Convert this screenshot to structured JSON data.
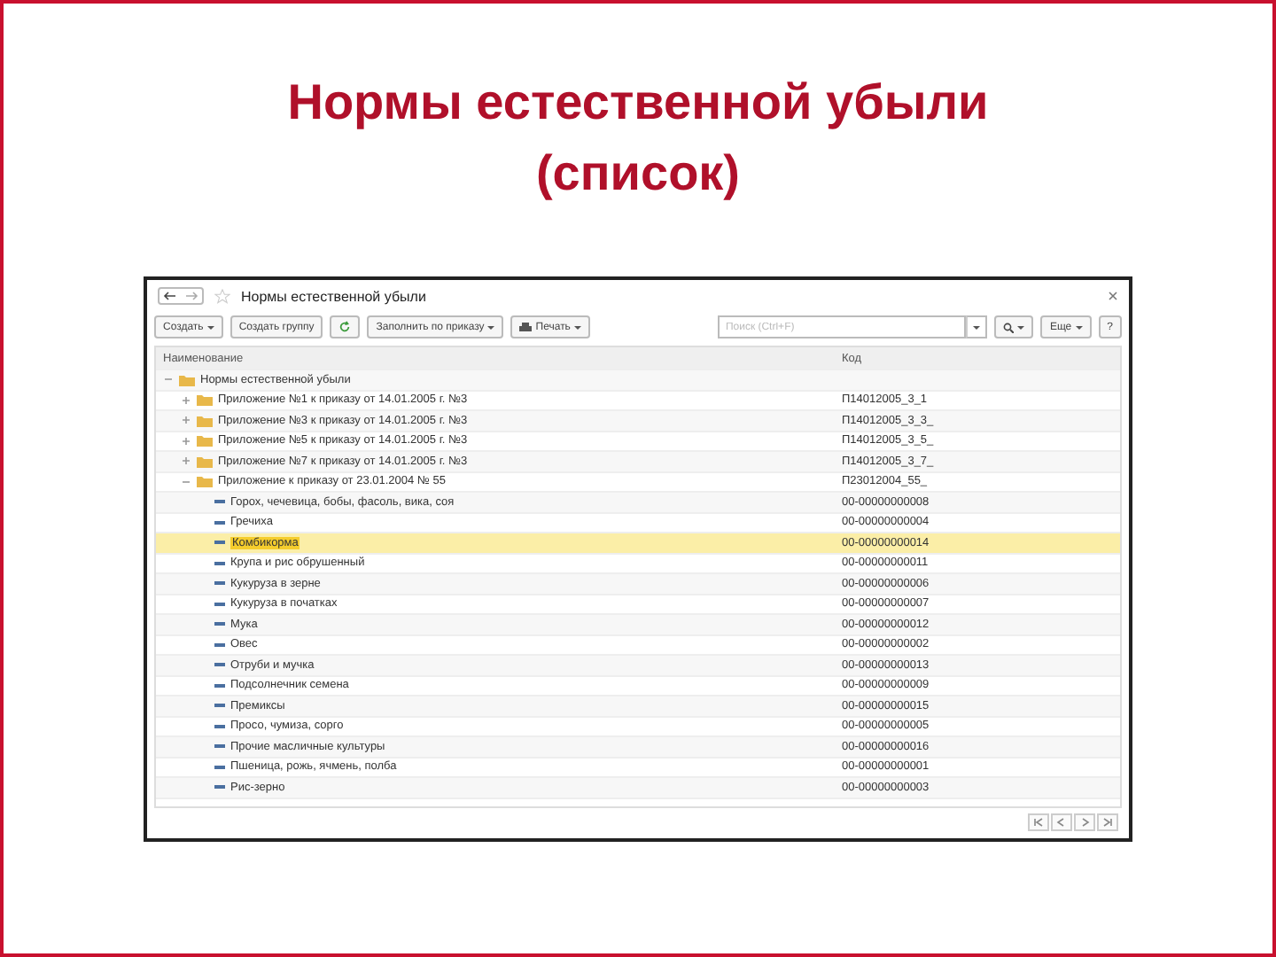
{
  "slide_title": "Нормы естественной убыли",
  "slide_subtitle": "(список)",
  "window": {
    "title": "Нормы естественной убыли",
    "favorite": false
  },
  "toolbar": {
    "buttons": [
      {
        "label": "Создать",
        "kind": "dropdown"
      },
      {
        "label": "Создать группу",
        "kind": "plain"
      },
      {
        "kind": "refresh"
      },
      {
        "label": "Заполнить по приказу",
        "kind": "dropdown"
      },
      {
        "label": "Печать",
        "kind": "print"
      }
    ],
    "search": {
      "placeholder": "Поиск (Ctrl+F)"
    },
    "more": "Еще",
    "help": "?"
  },
  "table": {
    "columns": [
      "Наименование",
      "Код"
    ],
    "rows": [
      {
        "kind": "group",
        "name": "Нормы естественной убыли",
        "code": "",
        "expanded": true,
        "selected": false,
        "children": [
          {
            "kind": "group",
            "name": "Приложение №1 к приказу от 14.01.2005 г. №3",
            "code": "П14012005_3_1",
            "expanded": false,
            "selected": false
          },
          {
            "kind": "group",
            "name": "Приложение №3 к приказу от 14.01.2005 г. №3",
            "code": "П14012005_3_3_",
            "expanded": false,
            "selected": false
          },
          {
            "kind": "group",
            "name": "Приложение №5 к приказу от 14.01.2005 г. №3",
            "code": "П14012005_3_5_",
            "expanded": false,
            "selected": false
          },
          {
            "kind": "group",
            "name": "Приложение №7 к приказу от 14.01.2005 г. №3",
            "code": "П14012005_3_7_",
            "expanded": false,
            "selected": false
          },
          {
            "kind": "group",
            "name": "Приложение к приказу от 23.01.2004 № 55",
            "code": "П23012004_55_",
            "expanded": true,
            "selected": false,
            "children": [
              {
                "kind": "item",
                "name": "Горох, чечевица, бобы, фасоль, вика, соя",
                "code": "00-00000000008",
                "selected": false
              },
              {
                "kind": "item",
                "name": "Гречиха",
                "code": "00-00000000004",
                "selected": false
              },
              {
                "kind": "item",
                "name": "Комбикорма",
                "code": "00-00000000014",
                "selected": true
              },
              {
                "kind": "item",
                "name": "Крупа и рис обрушенный",
                "code": "00-00000000011",
                "selected": false
              },
              {
                "kind": "item",
                "name": "Кукуруза в зерне",
                "code": "00-00000000006",
                "selected": false
              },
              {
                "kind": "item",
                "name": "Кукуруза в початках",
                "code": "00-00000000007",
                "selected": false
              },
              {
                "kind": "item",
                "name": "Мука",
                "code": "00-00000000012",
                "selected": false
              },
              {
                "kind": "item",
                "name": "Овес",
                "code": "00-00000000002",
                "selected": false
              },
              {
                "kind": "item",
                "name": "Отруби и мучка",
                "code": "00-00000000013",
                "selected": false
              },
              {
                "kind": "item",
                "name": "Подсолнечник семена",
                "code": "00-00000000009",
                "selected": false
              },
              {
                "kind": "item",
                "name": "Премиксы",
                "code": "00-00000000015",
                "selected": false
              },
              {
                "kind": "item",
                "name": "Просо, чумиза, сорго",
                "code": "00-00000000005",
                "selected": false
              },
              {
                "kind": "item",
                "name": "Прочие масличные культуры",
                "code": "00-00000000016",
                "selected": false
              },
              {
                "kind": "item",
                "name": "Пшеница, рожь, ячмень, полба",
                "code": "00-00000000001",
                "selected": false
              },
              {
                "kind": "item",
                "name": "Рис-зерно",
                "code": "00-00000000003",
                "selected": false
              }
            ]
          }
        ]
      }
    ]
  }
}
